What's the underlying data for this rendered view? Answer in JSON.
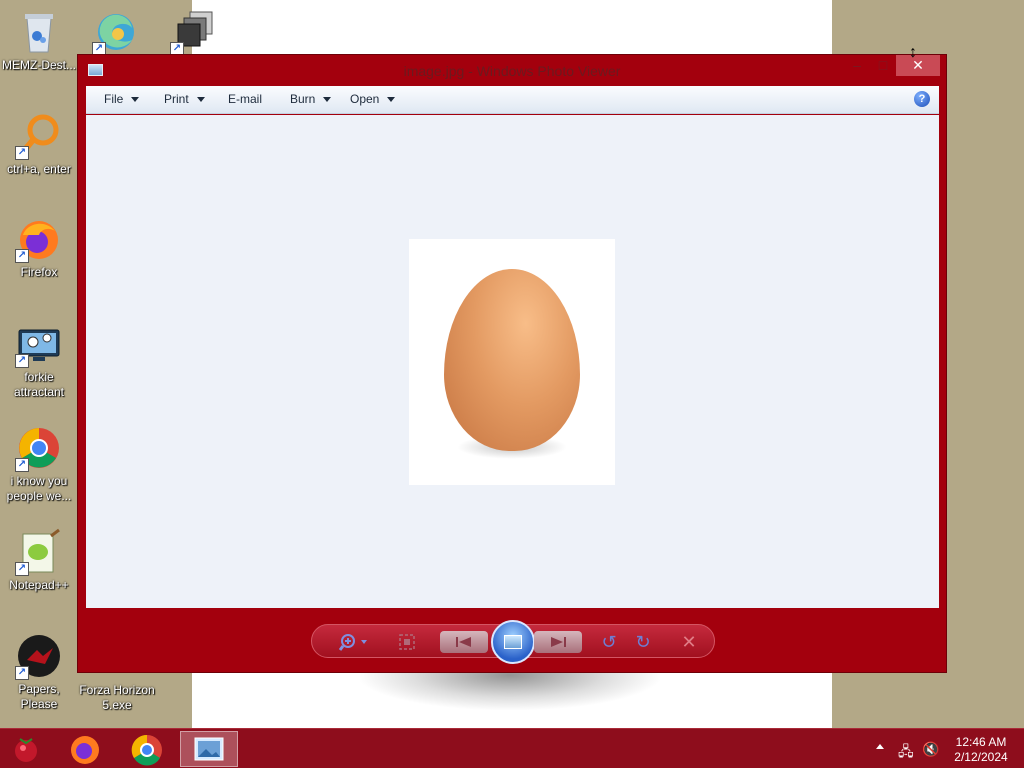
{
  "desktop": {
    "icons": [
      {
        "label": "MEMZ-Dest...",
        "icon": "recycle-bin-icon"
      },
      {
        "label": "",
        "icon": "edge-icon"
      },
      {
        "label": "",
        "icon": "windows-stack-icon"
      },
      {
        "label": "ctrl+a, enter",
        "icon": "magnifier-icon"
      },
      {
        "label": "Firefox",
        "icon": "firefox-icon"
      },
      {
        "label": "forkie attractant",
        "icon": "computer-settings-icon"
      },
      {
        "label": "i know you people we...",
        "icon": "chrome-icon"
      },
      {
        "label": "Notepad++",
        "icon": "notepad-plus-plus-icon"
      },
      {
        "label": "Papers, Please",
        "icon": "papers-please-icon"
      },
      {
        "label": "Forza Horizon 5.exe",
        "icon": "forza-icon"
      }
    ]
  },
  "window": {
    "title": "image.jpg - Windows Photo Viewer",
    "controls": {
      "minimize": "–",
      "maximize": "□",
      "close": "✕"
    },
    "menu": [
      {
        "label": "File",
        "dropdown": true
      },
      {
        "label": "Print",
        "dropdown": true
      },
      {
        "label": "E-mail",
        "dropdown": false
      },
      {
        "label": "Burn",
        "dropdown": true
      },
      {
        "label": "Open",
        "dropdown": true
      }
    ],
    "help": "?",
    "image": {
      "subject": "egg"
    },
    "toolbar": {
      "zoom": "zoom-icon",
      "actual_size": "actual-size-icon",
      "previous": "previous-icon",
      "slideshow": "slideshow-icon",
      "next": "next-icon",
      "rotate_ccw": "rotate-counterclockwise-icon",
      "rotate_cw": "rotate-clockwise-icon",
      "delete": "delete-icon"
    }
  },
  "taskbar": {
    "clock_time": "12:46 AM",
    "clock_date": "2/12/2024",
    "colors": {
      "bar": "#8e0d1c",
      "window": "#a3000d"
    }
  }
}
